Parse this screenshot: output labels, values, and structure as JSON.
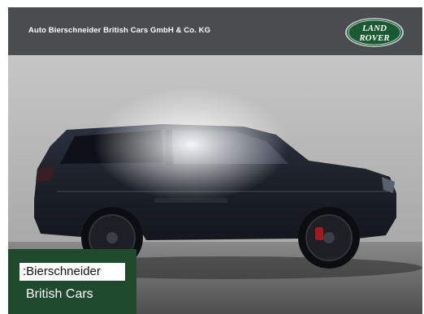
{
  "header": {
    "dealer_name": "Auto Bierschneider British Cars GmbH & Co. KG",
    "logo_line1": "LAND",
    "logo_line2": "ROVER",
    "logo_colors": {
      "green": "#1a5a33",
      "silver": "#d8d8d8"
    }
  },
  "photo": {
    "subject": "vehicle-icon",
    "colors": {
      "body": "#1c2029",
      "backdrop": "#b9b9b9",
      "ground": "#6a6a6a"
    }
  },
  "badge": {
    "line1": ":Bierschneider",
    "line2": "British Cars",
    "color": "#1f4a2e"
  }
}
